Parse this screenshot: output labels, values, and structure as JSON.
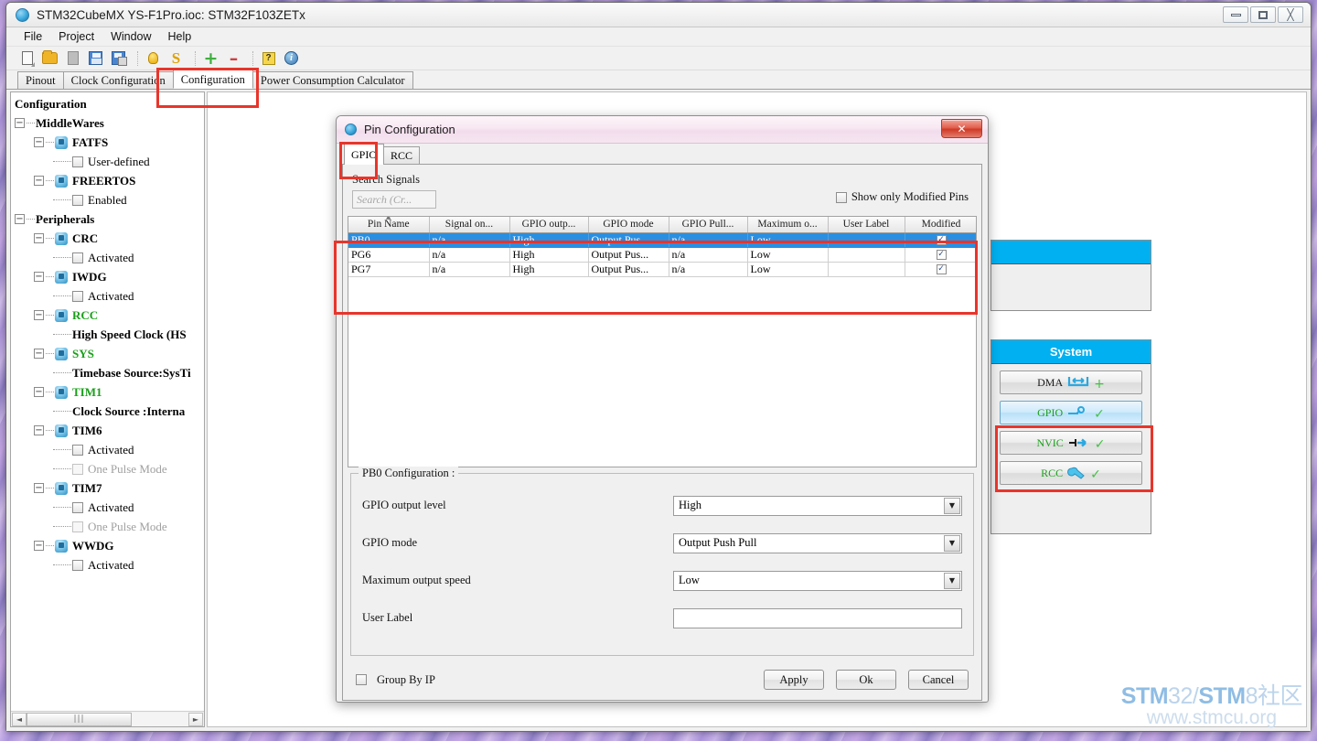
{
  "window": {
    "title": "STM32CubeMX YS-F1Pro.ioc: STM32F103ZETx",
    "minimize": "—",
    "maximize": "❐",
    "close": "✕"
  },
  "menubar": {
    "items": [
      "File",
      "Project",
      "Window",
      "Help"
    ]
  },
  "toolbar": {
    "icons": [
      "new-project-icon",
      "open-project-icon",
      "document-icon",
      "save-icon",
      "save-as-icon",
      "generate-code-icon",
      "stm32cube-icon",
      "add-icon",
      "remove-icon",
      "help-icon",
      "about-icon"
    ]
  },
  "main_tabs": [
    {
      "label": "Pinout",
      "active": false
    },
    {
      "label": "Clock Configuration",
      "active": false
    },
    {
      "label": "Configuration",
      "active": true
    },
    {
      "label": "Power Consumption Calculator",
      "active": false
    }
  ],
  "tree": {
    "root": "Configuration",
    "nodes": [
      {
        "label": "MiddleWares",
        "depth": 1,
        "type": "group",
        "expander": "−"
      },
      {
        "label": "FATFS",
        "depth": 2,
        "type": "ip",
        "expander": "−"
      },
      {
        "label": "User-defined",
        "depth": 3,
        "type": "check",
        "checked": false
      },
      {
        "label": "FREERTOS",
        "depth": 2,
        "type": "ip",
        "expander": "−"
      },
      {
        "label": "Enabled",
        "depth": 3,
        "type": "check",
        "checked": false
      },
      {
        "label": "Peripherals",
        "depth": 1,
        "type": "group",
        "expander": "−"
      },
      {
        "label": "CRC",
        "depth": 2,
        "type": "ip",
        "expander": "−"
      },
      {
        "label": "Activated",
        "depth": 3,
        "type": "check",
        "checked": false
      },
      {
        "label": "IWDG",
        "depth": 2,
        "type": "ip",
        "expander": "−"
      },
      {
        "label": "Activated",
        "depth": 3,
        "type": "check",
        "checked": false
      },
      {
        "label": "RCC",
        "depth": 2,
        "type": "ip-green",
        "expander": "−"
      },
      {
        "label": "High Speed Clock (HS",
        "depth": 3,
        "type": "leaf"
      },
      {
        "label": "SYS",
        "depth": 2,
        "type": "ip-green",
        "expander": "−"
      },
      {
        "label": "Timebase Source:SysTi",
        "depth": 3,
        "type": "leaf"
      },
      {
        "label": "TIM1",
        "depth": 2,
        "type": "ip-green",
        "expander": "−"
      },
      {
        "label": "Clock Source :Interna",
        "depth": 3,
        "type": "leaf"
      },
      {
        "label": "TIM6",
        "depth": 2,
        "type": "ip",
        "expander": "−"
      },
      {
        "label": "Activated",
        "depth": 3,
        "type": "check",
        "checked": false
      },
      {
        "label": "One Pulse Mode",
        "depth": 3,
        "type": "check-dim",
        "checked": false
      },
      {
        "label": "TIM7",
        "depth": 2,
        "type": "ip",
        "expander": "−"
      },
      {
        "label": "Activated",
        "depth": 3,
        "type": "check",
        "checked": false
      },
      {
        "label": "One Pulse Mode",
        "depth": 3,
        "type": "check-dim",
        "checked": false
      },
      {
        "label": "WWDG",
        "depth": 2,
        "type": "ip",
        "expander": "−"
      },
      {
        "label": "Activated",
        "depth": 3,
        "type": "check",
        "checked": false
      }
    ],
    "hscroll_thumb": "|||",
    "hscroll_left": "◄",
    "hscroll_right": "►"
  },
  "right_panels": {
    "top_panel": {
      "title": ""
    },
    "system_panel": {
      "title": "System",
      "buttons": [
        {
          "label": "DMA",
          "icon": "dma-arrows-icon",
          "selected": false,
          "badge": "+"
        },
        {
          "label": "GPIO",
          "icon": "gpio-pin-icon",
          "selected": true,
          "badge": "✓"
        },
        {
          "label": "NVIC",
          "icon": "nvic-arrow-icon",
          "selected": false,
          "badge": "✓"
        },
        {
          "label": "RCC",
          "icon": "rcc-wrench-icon",
          "selected": false,
          "badge": "✓"
        }
      ]
    }
  },
  "dialog": {
    "title": "Pin Configuration",
    "close_label": "✕",
    "tabs": [
      {
        "label": "GPIO",
        "active": true
      },
      {
        "label": "RCC",
        "active": false
      }
    ],
    "search": {
      "label": "Search Signals",
      "placeholder": "Search (Cr...",
      "value": ""
    },
    "modified_only": {
      "label": "Show only Modified Pins",
      "checked": false
    },
    "table": {
      "columns": [
        "Pin Name",
        "Signal on...",
        "GPIO outp...",
        "GPIO mode",
        "GPIO Pull...",
        "Maximum o...",
        "User Label",
        "Modified"
      ],
      "sorted_column": 0,
      "rows": [
        {
          "selected": true,
          "cells": [
            "PB0",
            "n/a",
            "High",
            "Output Pus...",
            "n/a",
            "Low",
            "",
            true
          ]
        },
        {
          "selected": false,
          "cells": [
            "PG6",
            "n/a",
            "High",
            "Output Pus...",
            "n/a",
            "Low",
            "",
            true
          ]
        },
        {
          "selected": false,
          "cells": [
            "PG7",
            "n/a",
            "High",
            "Output Pus...",
            "n/a",
            "Low",
            "",
            true
          ]
        }
      ],
      "check_glyph": "✓"
    },
    "config_group": {
      "title": "PB0 Configuration :",
      "fields": [
        {
          "label": "GPIO output level",
          "value": "High",
          "type": "select"
        },
        {
          "label": "GPIO mode",
          "value": "Output Push Pull",
          "type": "select"
        },
        {
          "label": "Maximum output speed",
          "value": "Low",
          "type": "select"
        },
        {
          "label": "User Label",
          "value": "",
          "type": "text"
        }
      ],
      "dropdown_arrow": "▼"
    },
    "group_by_ip": {
      "label": "Group By IP",
      "checked": false
    },
    "buttons": [
      {
        "label": "Apply"
      },
      {
        "label": "Ok"
      },
      {
        "label": "Cancel"
      }
    ]
  },
  "watermark": {
    "line1_a": "STM",
    "line1_b": "32/",
    "line1_c": "STM",
    "line1_d": "8社区",
    "line2": "www.stmcu.org"
  }
}
